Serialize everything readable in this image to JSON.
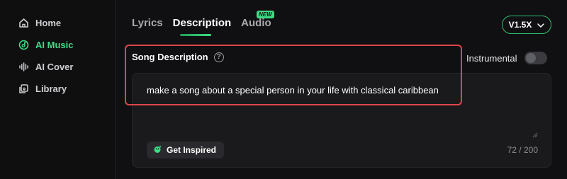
{
  "sidebar": {
    "items": [
      {
        "label": "Home",
        "icon": "home-icon",
        "active": false
      },
      {
        "label": "AI Music",
        "icon": "music-disc-icon",
        "active": true
      },
      {
        "label": "AI Cover",
        "icon": "waveform-icon",
        "active": false
      },
      {
        "label": "Library",
        "icon": "library-icon",
        "active": false
      }
    ]
  },
  "tabs": [
    {
      "label": "Lyrics",
      "active": false
    },
    {
      "label": "Description",
      "active": true
    },
    {
      "label": "Audio",
      "active": false,
      "badge": "NEW"
    }
  ],
  "version": {
    "label": "V1.5X"
  },
  "song_description": {
    "label": "Song Description",
    "value": "make a song about a special person in your life with classical caribbean",
    "char_count": "72 / 200",
    "inspire_label": "Get Inspired"
  },
  "instrumental": {
    "label": "Instrumental",
    "enabled": false
  },
  "colors": {
    "accent": "#3ddc84",
    "highlight": "#e0454a",
    "background": "#101012"
  }
}
